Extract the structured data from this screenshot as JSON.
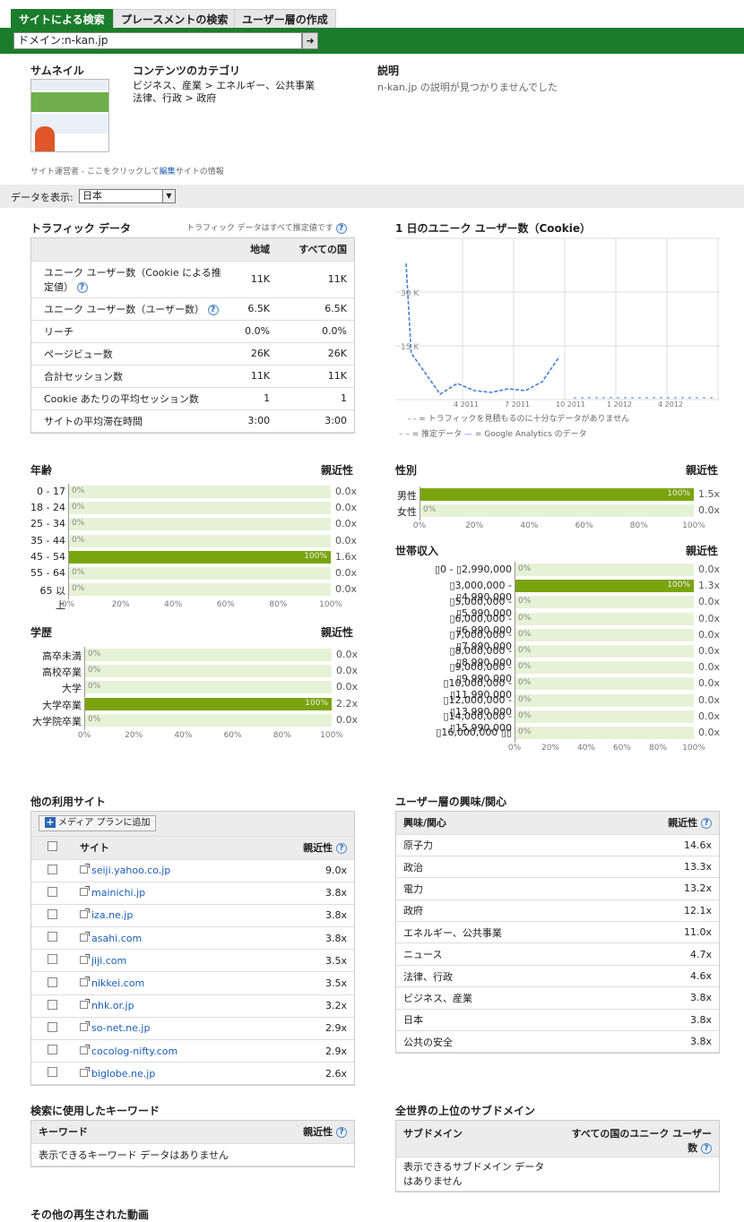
{
  "tabs": [
    "サイトによる検索",
    "プレースメントの検索",
    "ユーザー層の作成"
  ],
  "search": {
    "value": "ドメイン:n-kan.jp",
    "go_icon": "arrow-right-icon"
  },
  "site_info": {
    "thumbnail_label": "サムネイル",
    "category_label": "コンテンツのカテゴリ",
    "category_lines": [
      "ビジネス、産業 > エネルギー、公共事業",
      "法律、行政 > 政府"
    ],
    "description_label": "説明",
    "description_text": "n-kan.jp の説明が見つかりませんでした",
    "operator_prefix": "サイト運営者 - ここをクリックして",
    "operator_link": "編集",
    "operator_suffix": "サイトの情報"
  },
  "display_data": {
    "label": "データを表示:",
    "selected": "日本"
  },
  "traffic": {
    "title": "トラフィック データ",
    "note": "トラフィック データはすべて推定値です",
    "col_region": "地域",
    "col_all": "すべての国",
    "rows": [
      {
        "label": "ユニーク ユーザー数（Cookie による推定値）",
        "region": "11K",
        "all": "11K"
      },
      {
        "label": "ユニーク ユーザー数（ユーザー数）",
        "region": "6.5K",
        "all": "6.5K"
      },
      {
        "label": "リーチ",
        "region": "0.0%",
        "all": "0.0%"
      },
      {
        "label": "ページビュー数",
        "region": "26K",
        "all": "26K"
      },
      {
        "label": "合計セッション数",
        "region": "11K",
        "all": "11K"
      },
      {
        "label": "Cookie あたりの平均セッション数",
        "region": "1",
        "all": "1"
      },
      {
        "label": "サイトの平均滞在時間",
        "region": "3:00",
        "all": "3:00"
      }
    ]
  },
  "daily_chart": {
    "title": "1 日のユニーク ユーザー数（Cookie）",
    "legend_insufficient": "= トラフィックを見積もるのに十分なデータがありません",
    "legend_estimate": "= 推定データ",
    "legend_ga": "= Google Analytics のデータ",
    "accent": "#4a7fd8"
  },
  "chart_data": [
    {
      "type": "line",
      "title": "1 日のユニーク ユーザー数（Cookie）",
      "x_ticks": [
        "4 2011",
        "7 2011",
        "10 2011",
        "1 2012",
        "4 2012"
      ],
      "y_ticks": [
        "15 K",
        "30 K"
      ],
      "ylim": [
        0,
        45000
      ],
      "series": [
        {
          "name": "推定データ",
          "style": "dashed",
          "x": [
            "2011-01",
            "2011-01",
            "2011-03",
            "2011-04",
            "2011-05",
            "2011-06",
            "2011-07",
            "2011-08",
            "2011-09",
            "2011-10"
          ],
          "values": [
            38000,
            13000,
            1500,
            4500,
            2500,
            2000,
            3000,
            2500,
            5000,
            12000
          ]
        }
      ]
    },
    {
      "type": "bar",
      "title": "年齢",
      "value_label": "親近性",
      "categories": [
        "0 - 17",
        "18 - 24",
        "25 - 34",
        "35 - 44",
        "45 - 54",
        "55 - 64",
        "65 以上"
      ],
      "values": [
        0,
        0,
        0,
        0,
        100,
        0,
        0
      ],
      "pct_labels": [
        "0%",
        "0%",
        "0%",
        "0%",
        "100%",
        "0%",
        "0%"
      ],
      "affinity": [
        "0.0x",
        "0.0x",
        "0.0x",
        "0.0x",
        "1.6x",
        "0.0x",
        "0.0x"
      ],
      "x_ticks": [
        "0%",
        "20%",
        "40%",
        "60%",
        "80%",
        "100%"
      ]
    },
    {
      "type": "bar",
      "title": "性別",
      "value_label": "親近性",
      "categories": [
        "男性",
        "女性"
      ],
      "values": [
        100,
        0
      ],
      "pct_labels": [
        "100%",
        "0%"
      ],
      "affinity": [
        "1.5x",
        "0.0x"
      ],
      "x_ticks": [
        "0%",
        "20%",
        "40%",
        "60%",
        "80%",
        "100%"
      ]
    },
    {
      "type": "bar",
      "title": "世帯収入",
      "value_label": "親近性",
      "categories": [
        "▯0 - ▯2,990,000",
        "▯3,000,000 - ▯4,990,000",
        "▯5,000,000 - ▯5,990,000",
        "▯6,000,000 - ▯6,990,000",
        "▯7,000,000 - ▯7,990,000",
        "▯8,000,000 - ▯8,990,000",
        "▯9,000,000 - ▯9,990,000",
        "▯10,000,000 - ▯11,990,000",
        "▯12,000,000 - ▯13,990,000",
        "▯14,000,000 - ▯15,990,000",
        "▯16,000,000 ▯▯"
      ],
      "values": [
        0,
        100,
        0,
        0,
        0,
        0,
        0,
        0,
        0,
        0,
        0
      ],
      "pct_labels": [
        "0%",
        "100%",
        "0%",
        "0%",
        "0%",
        "0%",
        "0%",
        "0%",
        "0%",
        "0%",
        "0%"
      ],
      "affinity": [
        "0.0x",
        "1.3x",
        "0.0x",
        "0.0x",
        "0.0x",
        "0.0x",
        "0.0x",
        "0.0x",
        "0.0x",
        "0.0x",
        "0.0x"
      ],
      "x_ticks": [
        "0%",
        "20%",
        "40%",
        "60%",
        "80%",
        "100%"
      ]
    },
    {
      "type": "bar",
      "title": "学歴",
      "value_label": "親近性",
      "categories": [
        "高卒未満",
        "高校卒業",
        "大学",
        "大学卒業",
        "大学院卒業"
      ],
      "values": [
        0,
        0,
        0,
        100,
        0
      ],
      "pct_labels": [
        "0%",
        "0%",
        "0%",
        "100%",
        "0%"
      ],
      "affinity": [
        "0.0x",
        "0.0x",
        "0.0x",
        "2.2x",
        "0.0x"
      ],
      "x_ticks": [
        "0%",
        "20%",
        "40%",
        "60%",
        "80%",
        "100%"
      ]
    }
  ],
  "other_sites": {
    "title": "他の利用サイト",
    "add_button": "メディア プランに追加",
    "col_site": "サイト",
    "col_affinity": "親近性",
    "rows": [
      {
        "site": "seiji.yahoo.co.jp",
        "affinity": "9.0x"
      },
      {
        "site": "mainichi.jp",
        "affinity": "3.8x"
      },
      {
        "site": "iza.ne.jp",
        "affinity": "3.8x"
      },
      {
        "site": "asahi.com",
        "affinity": "3.8x"
      },
      {
        "site": "jiji.com",
        "affinity": "3.5x"
      },
      {
        "site": "nikkei.com",
        "affinity": "3.5x"
      },
      {
        "site": "nhk.or.jp",
        "affinity": "3.2x"
      },
      {
        "site": "so-net.ne.jp",
        "affinity": "2.9x"
      },
      {
        "site": "cocolog-nifty.com",
        "affinity": "2.9x"
      },
      {
        "site": "biglobe.ne.jp",
        "affinity": "2.6x"
      }
    ]
  },
  "interests": {
    "title": "ユーザー層の興味/関心",
    "col_interest": "興味/関心",
    "col_affinity": "親近性",
    "rows": [
      {
        "label": "原子力",
        "affinity": "14.6x"
      },
      {
        "label": "政治",
        "affinity": "13.3x"
      },
      {
        "label": "電力",
        "affinity": "13.2x"
      },
      {
        "label": "政府",
        "affinity": "12.1x"
      },
      {
        "label": "エネルギー、公共事業",
        "affinity": "11.0x"
      },
      {
        "label": "ニュース",
        "affinity": "4.7x"
      },
      {
        "label": "法律、行政",
        "affinity": "4.6x"
      },
      {
        "label": "ビジネス、産業",
        "affinity": "3.8x"
      },
      {
        "label": "日本",
        "affinity": "3.8x"
      },
      {
        "label": "公共の安全",
        "affinity": "3.8x"
      }
    ]
  },
  "keywords": {
    "title": "検索に使用したキーワード",
    "col_keyword": "キーワード",
    "col_affinity": "親近性",
    "empty": "表示できるキーワード データはありません"
  },
  "subdomains": {
    "title": "全世界の上位のサブドメイン",
    "col_subdomain": "サブドメイン",
    "col_users": "すべての国のユニーク ユーザー数",
    "empty": "表示できるサブドメイン データはありません"
  },
  "videos": {
    "title": "その他の再生された動画"
  }
}
